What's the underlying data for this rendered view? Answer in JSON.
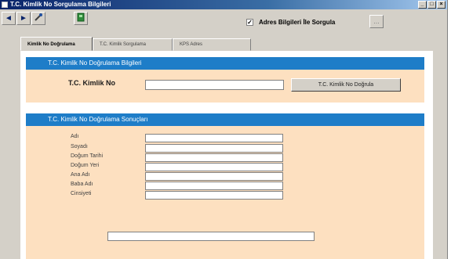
{
  "window": {
    "title": "T.C. Kimlik No Sorgulama Bilgileri",
    "controls": [
      "_",
      "□",
      "×"
    ]
  },
  "toolbar": {
    "back_glyph": "◄",
    "forward_glyph": "►",
    "checkbox_checked_glyph": "✓",
    "checkbox_label": "Adres Bilgileri İle Sorgula",
    "small_button_glyph": "..."
  },
  "tabs": [
    {
      "label": "Kimlik No Doğrulama",
      "active": true
    },
    {
      "label": "T.C. Kimlik Sorgulama",
      "active": false
    },
    {
      "label": "KPS Adres",
      "active": false
    }
  ],
  "verify_section": {
    "title": "T.C. Kimlik No Doğrulama Bilgileri",
    "tc_label": "T.C. Kimlik No",
    "tc_value": "",
    "verify_button": "T.C. Kimlik No Doğrula"
  },
  "results_section": {
    "title": "T.C. Kimlik No Doğrulama Sonuçları",
    "fields": [
      {
        "label": "Adı",
        "value": ""
      },
      {
        "label": "Soyadı",
        "value": ""
      },
      {
        "label": "Doğum Tarihi",
        "value": ""
      },
      {
        "label": "Doğum Yeri",
        "value": ""
      },
      {
        "label": "Ana Adı",
        "value": ""
      },
      {
        "label": "Baba Adı",
        "value": ""
      },
      {
        "label": "Cinsiyeti",
        "value": ""
      }
    ],
    "status_value": ""
  },
  "colors": {
    "section_header": "#1e7dc8",
    "section_body": "#fde0c0",
    "titlebar": "#0a246a"
  }
}
